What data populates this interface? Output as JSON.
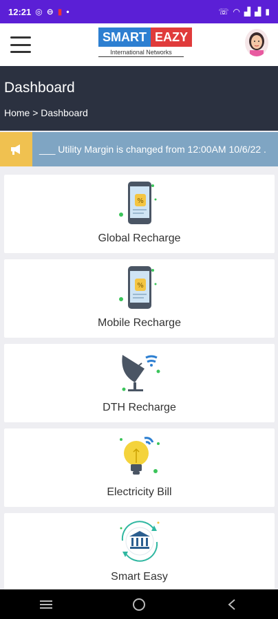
{
  "status_bar": {
    "time": "12:21"
  },
  "header": {
    "logo_smart": "SMART",
    "logo_eazy": "EAZY",
    "logo_subtitle": "International Networks"
  },
  "dashboard": {
    "title": "Dashboard",
    "breadcrumb": "Home > Dashboard"
  },
  "ticker": {
    "text": "___ Utility Margin is changed from 12:00AM 10/6/22 ."
  },
  "services": [
    {
      "label": "Global Recharge",
      "icon": "phone-percent-icon"
    },
    {
      "label": "Mobile Recharge",
      "icon": "phone-percent-icon"
    },
    {
      "label": "DTH Recharge",
      "icon": "satellite-dish-icon"
    },
    {
      "label": "Electricity Bill",
      "icon": "lightbulb-icon"
    },
    {
      "label": "Smart Easy",
      "icon": "bank-icon"
    }
  ],
  "colors": {
    "status_bar": "#5b1fd6",
    "dashboard_header": "#2b3140",
    "ticker_bg": "#7fa5c3",
    "ticker_icon_bg": "#f0c150",
    "logo_blue": "#2d7fd1",
    "logo_red": "#e03b3b"
  }
}
